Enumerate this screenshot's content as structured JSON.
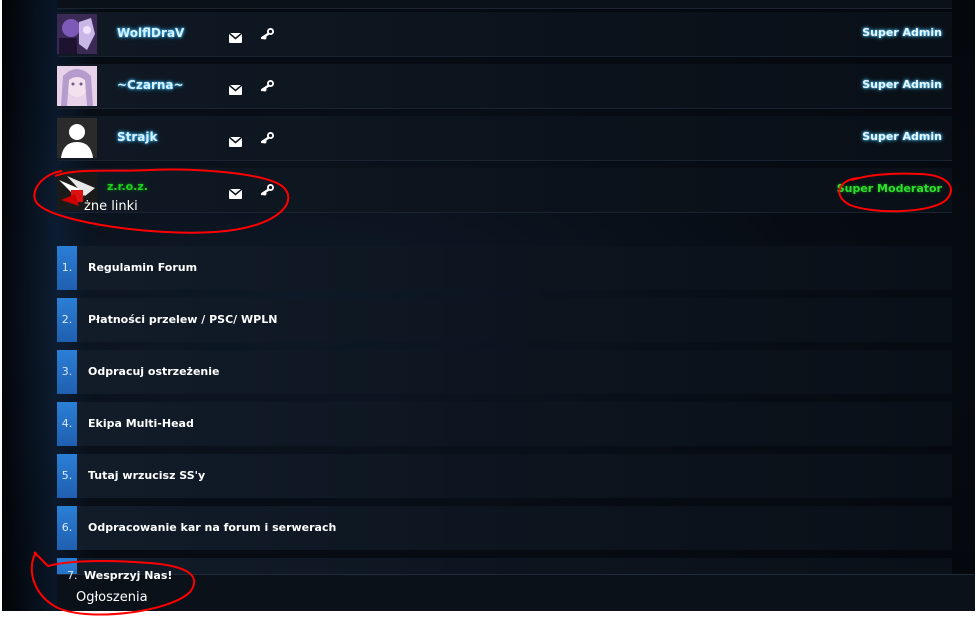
{
  "staff": [
    {
      "name": "WolflDraV",
      "role": "Super Admin",
      "avatar": "avatar-wolf"
    },
    {
      "name": "~Czarna~",
      "role": "Super Admin",
      "avatar": "avatar-anime-girl"
    },
    {
      "name": "Strajk",
      "role": "Super Admin",
      "avatar": "avatar-default-silhouette"
    },
    {
      "name": "z.r.o.z.",
      "role": "Super Moderator",
      "avatar": "avatar-red-white"
    }
  ],
  "overlay": {
    "section_label_partial": "żne linki",
    "footer_label": "Ogłoszenia"
  },
  "links": [
    {
      "num": "1.",
      "label": "Regulamin Forum"
    },
    {
      "num": "2.",
      "label": "Płatności przelew / PSC/ WPLN"
    },
    {
      "num": "3.",
      "label": "Odpracuj ostrzeżenie"
    },
    {
      "num": "4.",
      "label": "Ekipa Multi-Head"
    },
    {
      "num": "5.",
      "label": "Tutaj wrzucisz SS'y"
    },
    {
      "num": "6.",
      "label": "Odpracowanie kar na forum i serwerach"
    },
    {
      "num": "7.",
      "label": "Wesprzyj Nas!"
    }
  ],
  "icons": {
    "mail": "envelope-icon",
    "steam": "steam-icon"
  },
  "colors": {
    "accent_blue": "#2b7fd6",
    "admin_glow": "#39b9ff",
    "moderator_green": "#1fd41f",
    "annotation_red": "#ff0000"
  }
}
